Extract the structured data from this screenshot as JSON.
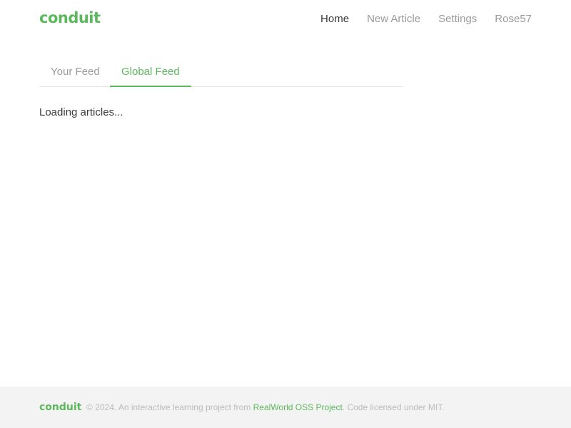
{
  "navbar": {
    "brand": "conduit",
    "links": [
      {
        "label": "Home",
        "active": true
      },
      {
        "label": "New Article",
        "active": false
      },
      {
        "label": "Settings",
        "active": false
      },
      {
        "label": "Rose57",
        "active": false
      }
    ]
  },
  "feed": {
    "tabs": [
      {
        "label": "Your Feed",
        "active": false
      },
      {
        "label": "Global Feed",
        "active": true
      }
    ],
    "status": "Loading articles..."
  },
  "footer": {
    "brand": "conduit",
    "prefix": "© 2024. An interactive learning project from ",
    "link": "RealWorld OSS Project",
    "suffix": ". Code licensed under MIT."
  },
  "colors": {
    "accent": "#5cb85c",
    "muted": "#9b9b9b",
    "text": "#373a3c",
    "footer_bg": "#f3f3f3"
  }
}
